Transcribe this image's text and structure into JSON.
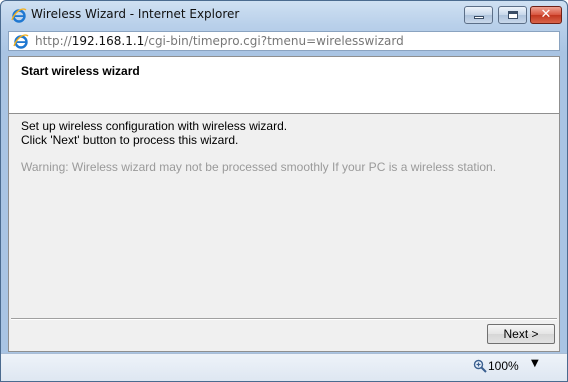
{
  "window": {
    "title": "Wireless Wizard - Internet Explorer",
    "title_icon": "ie-logo-icon",
    "controls": {
      "minimize_icon": "minimize-icon",
      "maximize_icon": "maximize-icon",
      "close_icon": "close-icon",
      "close_glyph": "✕"
    }
  },
  "address": {
    "scheme": "http://",
    "host": "192.168.1.1",
    "path": "/cgi-bin/timepro.cgi?tmenu=wirelesswizard"
  },
  "page": {
    "title": "Start wireless wizard",
    "description_line1": "Set up wireless configuration with wireless wizard.",
    "description_line2": "Click 'Next' button to process this wizard.",
    "warning": "Warning: Wireless wizard may not be processed smoothly If your PC is a wireless station.",
    "next_label": "Next >"
  },
  "statusbar": {
    "zoom": "100%",
    "zoom_icon": "zoom-magnifier-icon",
    "zoom_caret": "▼"
  },
  "colors": {
    "titlebar": "#b9d0ea",
    "content_bg": "#f0f0f0",
    "warning_text": "#9a9a9a",
    "close_button": "#c2361f"
  }
}
